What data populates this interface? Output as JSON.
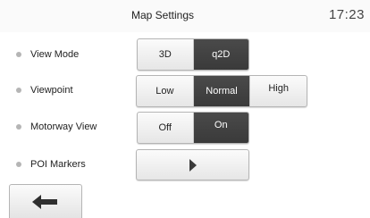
{
  "header": {
    "title": "Map Settings",
    "time": "17:23"
  },
  "settings": [
    {
      "label": "View Mode",
      "options": [
        "3D",
        "q2D"
      ],
      "selected": "q2D"
    },
    {
      "label": "Viewpoint",
      "options": [
        "Low",
        "Normal",
        "High"
      ],
      "selected": "Normal"
    },
    {
      "label": "Motorway View",
      "options": [
        "Off",
        "On"
      ],
      "selected": "On"
    },
    {
      "label": "POI Markers",
      "icon": "play-arrow-icon"
    }
  ],
  "nav": {
    "back_icon": "left-arrow-icon"
  },
  "colors": {
    "selected_bg": "#3f3f3f",
    "selected_text": "#ffffff",
    "button_bg": "#f0f0f0"
  }
}
